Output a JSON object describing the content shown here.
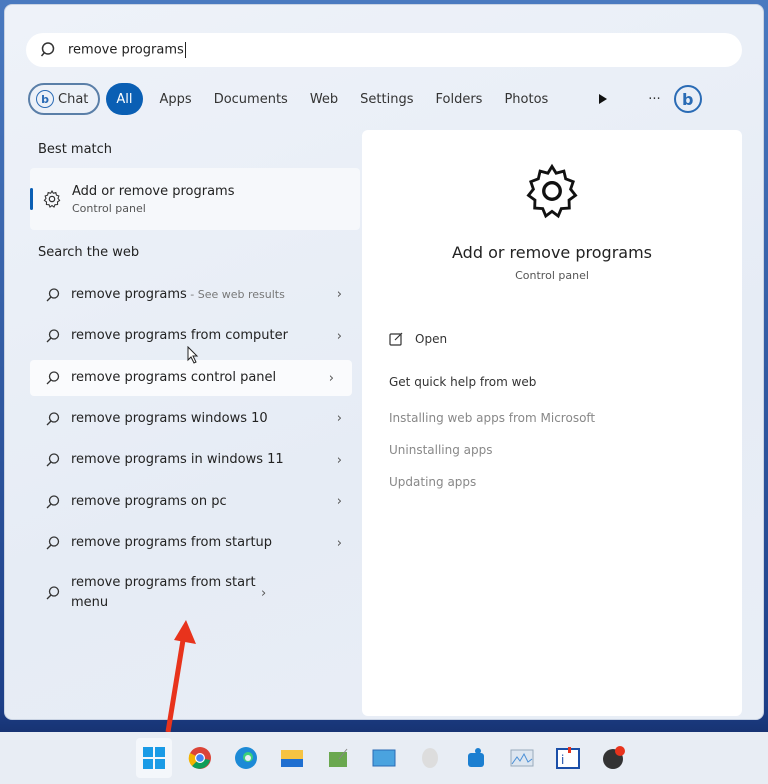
{
  "search": {
    "value": "remove programs"
  },
  "filters": [
    {
      "label": "Chat"
    },
    {
      "label": "All"
    },
    {
      "label": "Apps"
    },
    {
      "label": "Documents"
    },
    {
      "label": "Web"
    },
    {
      "label": "Settings"
    },
    {
      "label": "Folders"
    },
    {
      "label": "Photos"
    }
  ],
  "filters_more": "···",
  "best_match": {
    "heading": "Best match",
    "title": "Add or remove programs",
    "subtitle": "Control panel"
  },
  "web": {
    "heading": "Search the web",
    "items": [
      {
        "prefix": "remove programs",
        "suffix": "",
        "muted": " - See web results"
      },
      {
        "prefix": "remove programs",
        "suffix": " from computer"
      },
      {
        "prefix": "remove programs",
        "suffix": " control panel"
      },
      {
        "prefix": "remove programs",
        "suffix": " windows 10"
      },
      {
        "prefix": "remove programs",
        "suffix": " in windows 11"
      },
      {
        "prefix": "remove programs",
        "suffix": " on pc"
      },
      {
        "prefix": "remove programs",
        "suffix": " from startup"
      },
      {
        "prefix": "remove programs",
        "suffix": " from start menu"
      }
    ]
  },
  "preview": {
    "title": "Add or remove programs",
    "subtitle": "Control panel",
    "open": "Open",
    "help_heading": "Get quick help from web",
    "links": [
      "Installing web apps from Microsoft",
      "Uninstalling apps",
      "Updating apps"
    ]
  },
  "taskbar": [
    "start-icon",
    "chrome-icon",
    "edge-icon",
    "file-explorer-icon",
    "app-icon",
    "photos-icon",
    "disk-icon",
    "app2-icon",
    "chart-app-icon",
    "info-app-icon",
    "recorder-icon"
  ],
  "colors": {
    "accent": "#0a5fb4",
    "highlight_arrow": "#e8331c"
  }
}
